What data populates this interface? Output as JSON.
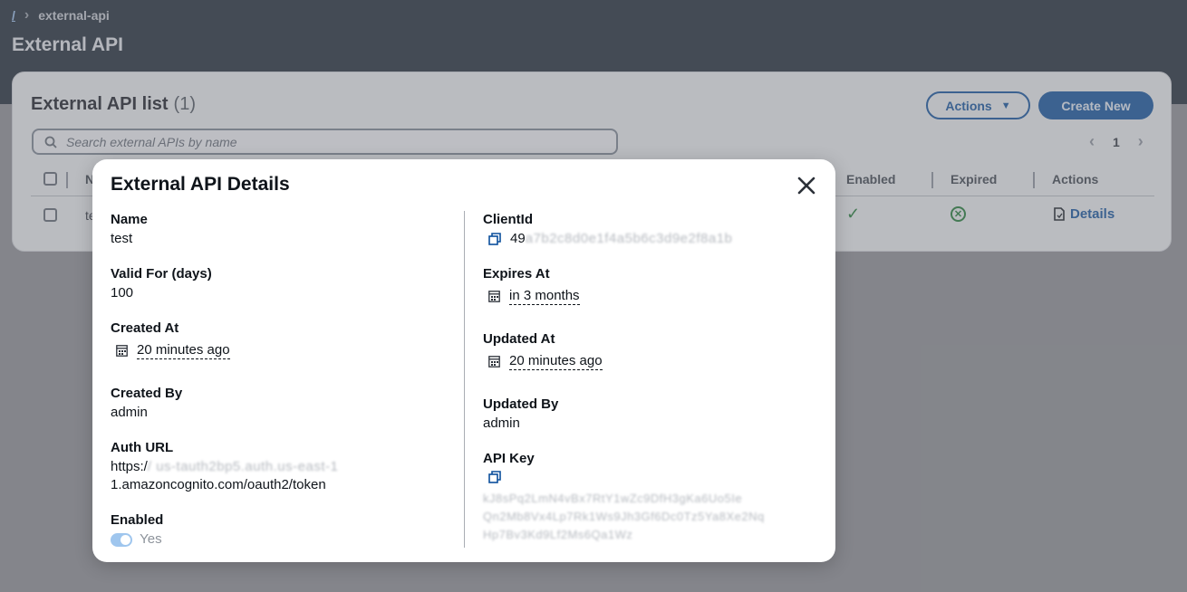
{
  "breadcrumb": {
    "root": "/",
    "current": "external-api"
  },
  "page": {
    "title": "External API"
  },
  "list": {
    "title": "External API list",
    "count": "(1)",
    "actions_label": "Actions",
    "create_label": "Create New",
    "search_placeholder": "Search external APIs by name",
    "page_number": "1",
    "columns": {
      "name": "N",
      "enabled": "Enabled",
      "expired": "Expired",
      "actions": "Actions"
    },
    "row": {
      "name": "te",
      "details_label": "Details"
    }
  },
  "modal": {
    "title": "External API Details",
    "name": {
      "label": "Name",
      "value": "test"
    },
    "valid_for": {
      "label": "Valid For (days)",
      "value": "100"
    },
    "created_at": {
      "label": "Created At",
      "value": "20 minutes ago"
    },
    "created_by": {
      "label": "Created By",
      "value": "admin"
    },
    "auth_url": {
      "label": "Auth URL",
      "value_line1_visible": "https:/",
      "value_line1_blurred": "/ us-tauth2bp5.auth.us-east-1",
      "value_line2": "1.amazoncognito.com/oauth2/token"
    },
    "enabled": {
      "label": "Enabled",
      "value": "Yes"
    },
    "client_id": {
      "label": "ClientId",
      "value_visible": "49",
      "value_blurred": "a7b2c8d0e1f4a5b6c3d9e2f8a1b"
    },
    "expires_at": {
      "label": "Expires At",
      "value": "in 3 months"
    },
    "updated_at": {
      "label": "Updated At",
      "value": "20 minutes ago"
    },
    "updated_by": {
      "label": "Updated By",
      "value": "admin"
    },
    "api_key": {
      "label": "API Key",
      "value_blurred_lines": [
        "kJ8sPq2LmN4vBx7RtY1wZc9DfH3gKa6Uo5Ie",
        "Qn2Mb8Vx4Lp7Rk1Ws9Jh3Gf6Dc0Tz5Ya8Xe2Nq",
        "Hp7Bv3Kd9Lf2Ms6Qa1Wz"
      ]
    }
  },
  "colors": {
    "primary": "#0b4f9c",
    "success": "#1b7a2e",
    "header_bg": "#1b2530"
  }
}
